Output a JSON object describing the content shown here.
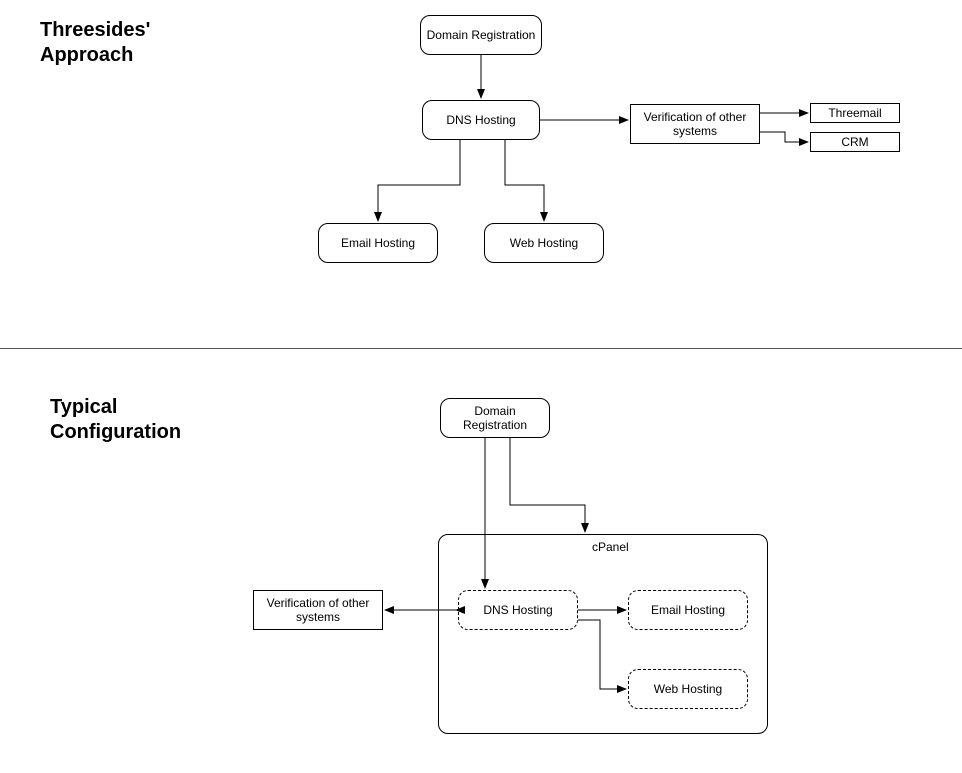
{
  "diagram1": {
    "title": "Threesides'\nApproach",
    "nodes": {
      "domain_registration": "Domain Registration",
      "dns_hosting": "DNS Hosting",
      "verification": "Verification of other systems",
      "threemail": "Threemail",
      "crm": "CRM",
      "email_hosting": "Email Hosting",
      "web_hosting": "Web Hosting"
    }
  },
  "diagram2": {
    "title": "Typical\nConfiguration",
    "container_label": "cPanel",
    "nodes": {
      "domain_registration": "Domain Registration",
      "dns_hosting": "DNS Hosting",
      "email_hosting": "Email Hosting",
      "web_hosting": "Web Hosting",
      "verification": "Verification of other systems"
    }
  }
}
